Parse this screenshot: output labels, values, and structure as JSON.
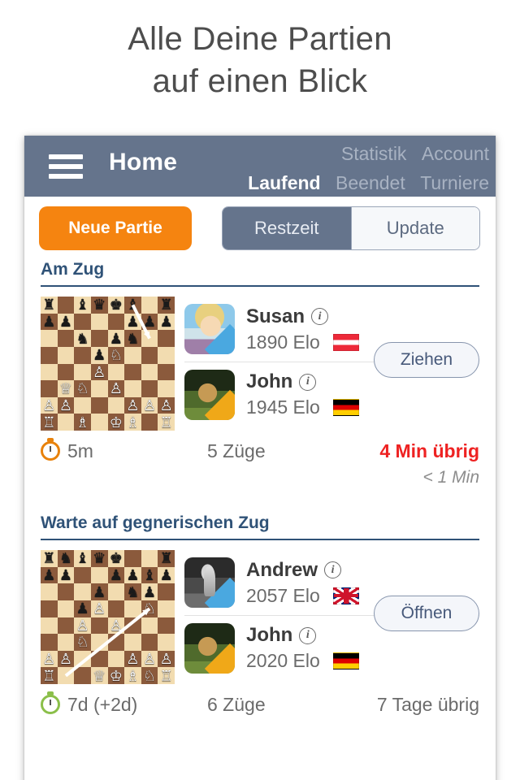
{
  "hero": {
    "line1": "Alle Deine Partien",
    "line2": "auf einen Blick"
  },
  "navbar": {
    "title": "Home",
    "menu_icon": "hamburger-icon",
    "links_top": [
      {
        "label": "Statistik",
        "active": false
      },
      {
        "label": "Account",
        "active": false
      }
    ],
    "links_bottom": [
      {
        "label": "Laufend",
        "active": true
      },
      {
        "label": "Beendet",
        "active": false
      },
      {
        "label": "Turniere",
        "active": false
      }
    ]
  },
  "toolbar": {
    "new_game_label": "Neue Partie",
    "segment_left": "Restzeit",
    "segment_right": "Update",
    "segment_selected": "Restzeit",
    "accent_orange": "#f58410",
    "accent_slate": "#65748c"
  },
  "sections": [
    {
      "title": "Am Zug",
      "game": {
        "action_label": "Ziehen",
        "players": [
          {
            "name": "Susan",
            "elo": "1890 Elo",
            "flag": "flag-austria",
            "avatar": "avatar-susan",
            "side_color": "#4aa8e0",
            "info_icon": "info-icon"
          },
          {
            "name": "John",
            "elo": "1945 Elo",
            "flag": "flag-germany",
            "avatar": "avatar-john",
            "side_color": "#f0a818",
            "info_icon": "info-icon"
          }
        ],
        "time_control": "5m",
        "moves": "5 Züge",
        "remaining": "4 Min übrig",
        "remaining_urgent": true,
        "sub_remaining": "< 1 Min",
        "clock_icon": "stopwatch-icon",
        "clock_color": "#e8820c",
        "board": {
          "light": "#f2dcb0",
          "dark": "#8b5a3c",
          "arrow": {
            "from": "f8",
            "to": "g6"
          },
          "pieces": [
            {
              "sq": "a8",
              "p": "r"
            },
            {
              "sq": "c8",
              "p": "b"
            },
            {
              "sq": "d8",
              "p": "q"
            },
            {
              "sq": "e8",
              "p": "k"
            },
            {
              "sq": "f8",
              "p": "b"
            },
            {
              "sq": "h8",
              "p": "r"
            },
            {
              "sq": "a7",
              "p": "p"
            },
            {
              "sq": "b7",
              "p": "p"
            },
            {
              "sq": "f7",
              "p": "p"
            },
            {
              "sq": "g7",
              "p": "p"
            },
            {
              "sq": "h7",
              "p": "p"
            },
            {
              "sq": "c6",
              "p": "n"
            },
            {
              "sq": "e6",
              "p": "p"
            },
            {
              "sq": "f6",
              "p": "n"
            },
            {
              "sq": "d5",
              "p": "p"
            },
            {
              "sq": "e5",
              "p": "N"
            },
            {
              "sq": "d4",
              "p": "P"
            },
            {
              "sq": "b3",
              "p": "Q"
            },
            {
              "sq": "c3",
              "p": "N"
            },
            {
              "sq": "e3",
              "p": "P"
            },
            {
              "sq": "a2",
              "p": "P"
            },
            {
              "sq": "b2",
              "p": "P"
            },
            {
              "sq": "f2",
              "p": "P"
            },
            {
              "sq": "g2",
              "p": "P"
            },
            {
              "sq": "h2",
              "p": "P"
            },
            {
              "sq": "a1",
              "p": "R"
            },
            {
              "sq": "c1",
              "p": "B"
            },
            {
              "sq": "e1",
              "p": "K"
            },
            {
              "sq": "f1",
              "p": "B"
            },
            {
              "sq": "h1",
              "p": "R"
            }
          ]
        }
      }
    },
    {
      "title": "Warte auf gegnerischen Zug",
      "game": {
        "action_label": "Öffnen",
        "players": [
          {
            "name": "Andrew",
            "elo": "2057 Elo",
            "flag": "flag-great-britain",
            "avatar": "avatar-andrew",
            "side_color": "#4aa8e0",
            "info_icon": "info-icon"
          },
          {
            "name": "John",
            "elo": "2020 Elo",
            "flag": "flag-germany",
            "avatar": "avatar-john",
            "side_color": "#f0a818",
            "info_icon": "info-icon"
          }
        ],
        "time_control": "7d (+2d)",
        "moves": "6 Züge",
        "remaining": "7 Tage übrig",
        "remaining_urgent": false,
        "sub_remaining": "",
        "clock_icon": "stopwatch-icon",
        "clock_color": "#8bbf4a",
        "board": {
          "light": "#f2dcb0",
          "dark": "#8b5a3c",
          "arrow": {
            "from": "b1",
            "to": "g5"
          },
          "pieces": [
            {
              "sq": "a8",
              "p": "r"
            },
            {
              "sq": "b8",
              "p": "n"
            },
            {
              "sq": "c8",
              "p": "b"
            },
            {
              "sq": "d8",
              "p": "q"
            },
            {
              "sq": "e8",
              "p": "k"
            },
            {
              "sq": "h8",
              "p": "r"
            },
            {
              "sq": "a7",
              "p": "p"
            },
            {
              "sq": "b7",
              "p": "p"
            },
            {
              "sq": "e7",
              "p": "p"
            },
            {
              "sq": "f7",
              "p": "p"
            },
            {
              "sq": "g7",
              "p": "b"
            },
            {
              "sq": "h7",
              "p": "p"
            },
            {
              "sq": "d6",
              "p": "p"
            },
            {
              "sq": "f6",
              "p": "n"
            },
            {
              "sq": "g6",
              "p": "p"
            },
            {
              "sq": "c5",
              "p": "p"
            },
            {
              "sq": "d5",
              "p": "P"
            },
            {
              "sq": "g5",
              "p": "N"
            },
            {
              "sq": "c4",
              "p": "P"
            },
            {
              "sq": "e4",
              "p": "P"
            },
            {
              "sq": "c3",
              "p": "N"
            },
            {
              "sq": "a2",
              "p": "P"
            },
            {
              "sq": "b2",
              "p": "P"
            },
            {
              "sq": "f2",
              "p": "P"
            },
            {
              "sq": "g2",
              "p": "P"
            },
            {
              "sq": "h2",
              "p": "P"
            },
            {
              "sq": "a1",
              "p": "R"
            },
            {
              "sq": "d1",
              "p": "Q"
            },
            {
              "sq": "e1",
              "p": "K"
            },
            {
              "sq": "f1",
              "p": "B"
            },
            {
              "sq": "g1",
              "p": "N"
            },
            {
              "sq": "h1",
              "p": "R"
            }
          ]
        }
      }
    }
  ]
}
